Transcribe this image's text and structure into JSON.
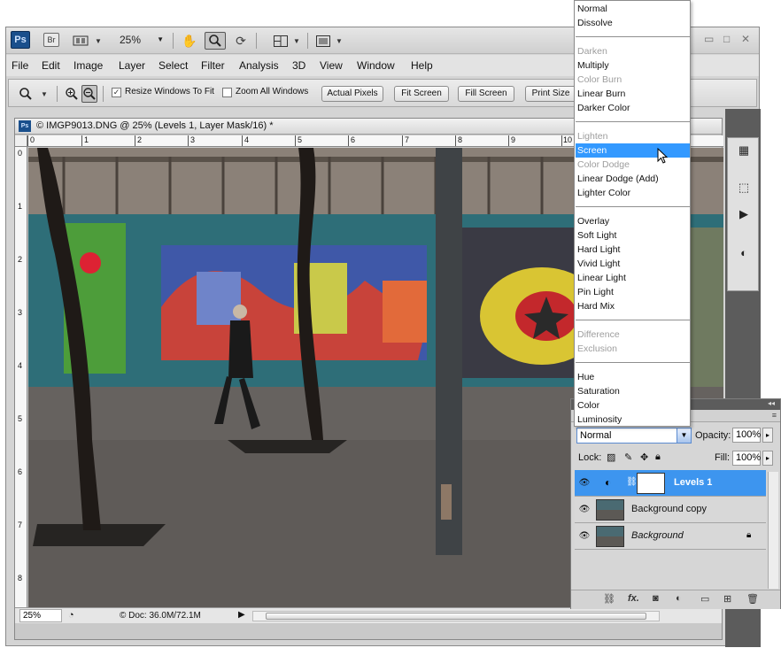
{
  "app": {
    "logo": "Ps",
    "bridge": "Br",
    "zoom": "25%"
  },
  "menu": [
    "File",
    "Edit",
    "Image",
    "Layer",
    "Select",
    "Filter",
    "Analysis",
    "3D",
    "View",
    "Window",
    "Help"
  ],
  "options": {
    "resize_windows": "Resize Windows To Fit",
    "zoom_all": "Zoom All Windows",
    "actual_pixels": "Actual Pixels",
    "fit_screen": "Fit Screen",
    "fill_screen": "Fill Screen",
    "print_size": "Print Size"
  },
  "document": {
    "title": "© IMGP9013.DNG @ 25% (Levels 1, Layer Mask/16) *",
    "zoom": "25%",
    "doc_info": "© Doc: 36.0M/72.1M",
    "ruler_top": [
      "0",
      "1",
      "2",
      "3",
      "4",
      "5",
      "6",
      "7",
      "8",
      "9",
      "10"
    ],
    "ruler_left": [
      "0",
      "1",
      "2",
      "3",
      "4",
      "5",
      "6",
      "7",
      "8"
    ]
  },
  "blend_modes": {
    "selected": "Screen",
    "groups": [
      [
        {
          "label": "Normal",
          "disabled": false
        },
        {
          "label": "Dissolve",
          "disabled": false
        }
      ],
      [
        {
          "label": "Darken",
          "disabled": true
        },
        {
          "label": "Multiply",
          "disabled": false
        },
        {
          "label": "Color Burn",
          "disabled": true
        },
        {
          "label": "Linear Burn",
          "disabled": false
        },
        {
          "label": "Darker Color",
          "disabled": false
        }
      ],
      [
        {
          "label": "Lighten",
          "disabled": true
        },
        {
          "label": "Screen",
          "disabled": false
        },
        {
          "label": "Color Dodge",
          "disabled": true
        },
        {
          "label": "Linear Dodge (Add)",
          "disabled": false
        },
        {
          "label": "Lighter Color",
          "disabled": false
        }
      ],
      [
        {
          "label": "Overlay",
          "disabled": false
        },
        {
          "label": "Soft Light",
          "disabled": false
        },
        {
          "label": "Hard Light",
          "disabled": false
        },
        {
          "label": "Vivid Light",
          "disabled": false
        },
        {
          "label": "Linear Light",
          "disabled": false
        },
        {
          "label": "Pin Light",
          "disabled": false
        },
        {
          "label": "Hard Mix",
          "disabled": false
        }
      ],
      [
        {
          "label": "Difference",
          "disabled": true
        },
        {
          "label": "Exclusion",
          "disabled": true
        }
      ],
      [
        {
          "label": "Hue",
          "disabled": false
        },
        {
          "label": "Saturation",
          "disabled": false
        },
        {
          "label": "Color",
          "disabled": false
        },
        {
          "label": "Luminosity",
          "disabled": false
        }
      ]
    ]
  },
  "layers": {
    "blend_value": "Normal",
    "opacity_label": "Opacity:",
    "opacity": "100%",
    "lock_label": "Lock:",
    "fill_label": "Fill:",
    "fill": "100%",
    "items": [
      {
        "name": "Levels 1",
        "selected": true
      },
      {
        "name": "Background copy",
        "selected": false
      },
      {
        "name": "Background",
        "selected": false
      }
    ],
    "footer_fx": "fx."
  },
  "colors": {
    "selection": "#3399ff",
    "layer_selected": "#3d95ef",
    "ps_blue": "#1a4f8c"
  }
}
